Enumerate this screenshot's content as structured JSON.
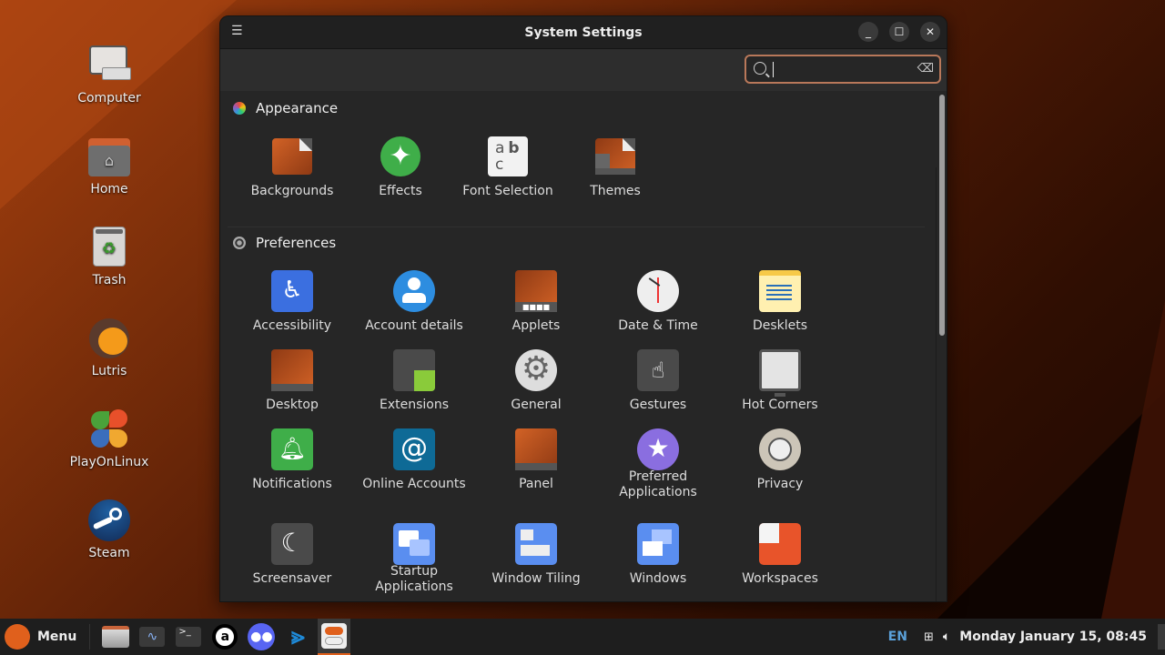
{
  "desktop": {
    "icons": [
      {
        "label": "Computer",
        "icon": "computer-icon"
      },
      {
        "label": "Home",
        "icon": "home-folder-icon"
      },
      {
        "label": "Trash",
        "icon": "trash-icon"
      },
      {
        "label": "Lutris",
        "icon": "lutris-icon"
      },
      {
        "label": "PlayOnLinux",
        "icon": "playonlinux-icon"
      },
      {
        "label": "Steam",
        "icon": "steam-icon"
      }
    ]
  },
  "window": {
    "title": "System Settings",
    "menu_icon": "hamburger-icon",
    "controls": {
      "minimize": "_",
      "maximize": "☐",
      "close": "✕"
    },
    "search": {
      "value": "",
      "placeholder": "",
      "clear_icon": "⌫"
    },
    "sections": [
      {
        "title": "Appearance",
        "items": [
          {
            "label": "Backgrounds"
          },
          {
            "label": "Effects"
          },
          {
            "label": "Font Selection"
          },
          {
            "label": "Themes"
          }
        ]
      },
      {
        "title": "Preferences",
        "items": [
          {
            "label": "Accessibility"
          },
          {
            "label": "Account details"
          },
          {
            "label": "Applets"
          },
          {
            "label": "Date & Time"
          },
          {
            "label": "Desklets"
          },
          {
            "label": "Desktop"
          },
          {
            "label": "Extensions"
          },
          {
            "label": "General"
          },
          {
            "label": "Gestures"
          },
          {
            "label": "Hot Corners"
          },
          {
            "label": "Notifications"
          },
          {
            "label": "Online Accounts"
          },
          {
            "label": "Panel"
          },
          {
            "label": "Preferred Applications"
          },
          {
            "label": "Privacy"
          },
          {
            "label": "Screensaver"
          },
          {
            "label": "Startup Applications"
          },
          {
            "label": "Window Tiling"
          },
          {
            "label": "Windows"
          },
          {
            "label": "Workspaces"
          }
        ]
      }
    ]
  },
  "panel": {
    "menu_label": "Menu",
    "taskbar": [
      "file-manager",
      "system-monitor",
      "terminal",
      "anydesk",
      "discord",
      "vscode",
      "system-settings"
    ],
    "keyboard_layout": "EN",
    "clock": "Monday January 15, 08:45"
  },
  "colors": {
    "accent": "#e0601c",
    "search_border": "#b9785a",
    "window_bg": "#262626"
  }
}
